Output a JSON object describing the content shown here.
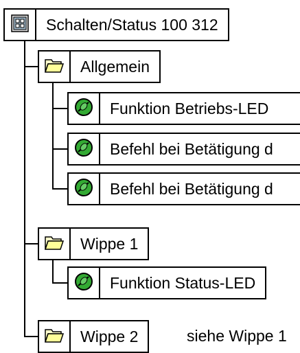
{
  "tree": {
    "root": {
      "label": "Schalten/Status 100 312",
      "icon": "device-module-icon"
    },
    "groups": [
      {
        "label": "Allgemein",
        "icon": "folder-icon",
        "items": [
          {
            "label": "Funktion Betriebs-LED",
            "icon": "parameter-icon"
          },
          {
            "label": "Befehl bei Betätigung d",
            "icon": "parameter-icon"
          },
          {
            "label": "Befehl bei Betätigung d",
            "icon": "parameter-icon"
          }
        ]
      },
      {
        "label": "Wippe 1",
        "icon": "folder-icon",
        "items": [
          {
            "label": "Funktion Status-LED",
            "icon": "parameter-icon"
          }
        ]
      },
      {
        "label": "Wippe 2",
        "icon": "folder-icon",
        "note": "siehe Wippe 1",
        "items": []
      }
    ]
  },
  "colors": {
    "folder_fill": "#ffff99",
    "parameter_fill": "#33aa33",
    "line": "#000000"
  }
}
